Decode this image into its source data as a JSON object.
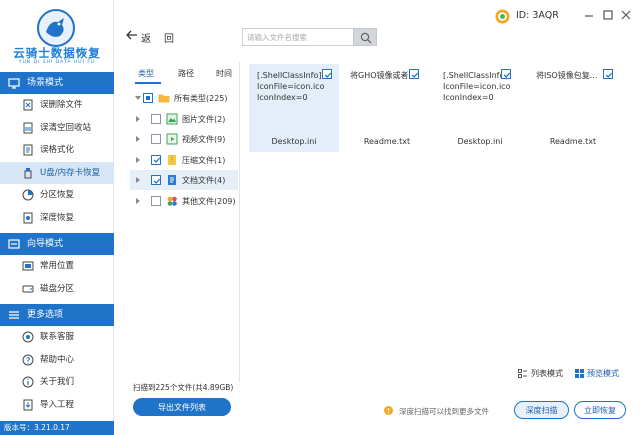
{
  "app": {
    "logo_title": "云骑士数据恢复",
    "logo_subtitle": "YUN QI SHI DATA HUI FU",
    "version_label": "版本号：3.21.0.17",
    "user_id": "ID: 3AQR",
    "accent_color": "#1f73c9"
  },
  "sidebar": {
    "sections": [
      {
        "title": "场景模式",
        "icon": "monitor-icon",
        "items": [
          {
            "label": "误删除文件",
            "icon": "file-delete-icon"
          },
          {
            "label": "误清空回收站",
            "icon": "recycle-bin-icon"
          },
          {
            "label": "误格式化",
            "icon": "format-icon"
          },
          {
            "label": "U盘/内存卡恢复",
            "icon": "usb-icon",
            "active": true
          },
          {
            "label": "分区恢复",
            "icon": "partition-icon"
          },
          {
            "label": "深度恢复",
            "icon": "deep-recovery-icon"
          }
        ]
      },
      {
        "title": "向导模式",
        "icon": "guide-icon",
        "items": [
          {
            "label": "常用位置",
            "icon": "location-icon"
          },
          {
            "label": "磁盘分区",
            "icon": "disk-icon"
          }
        ]
      },
      {
        "title": "更多选项",
        "icon": "menu-icon",
        "items": [
          {
            "label": "联系客服",
            "icon": "customer-service-icon"
          },
          {
            "label": "帮助中心",
            "icon": "help-icon"
          },
          {
            "label": "关于我们",
            "icon": "info-icon"
          },
          {
            "label": "导入工程",
            "icon": "import-icon"
          }
        ]
      }
    ]
  },
  "toolbar": {
    "back_label": "返",
    "home_label": "回",
    "search_placeholder": "请输入文件名搜索"
  },
  "tree": {
    "tabs": [
      "类型",
      "路径",
      "时间"
    ],
    "active_tab": 0,
    "rows": [
      {
        "label": "所有类型(225)",
        "checked": "partial",
        "icon": "folder-icon",
        "expandable": false,
        "level": 0
      },
      {
        "label": "图片文件(2)",
        "checked": false,
        "icon": "image-file-icon",
        "expandable": true,
        "level": 1
      },
      {
        "label": "视频文件(9)",
        "checked": false,
        "icon": "video-file-icon",
        "expandable": true,
        "level": 1
      },
      {
        "label": "压缩文件(1)",
        "checked": true,
        "icon": "archive-file-icon",
        "expandable": true,
        "level": 1
      },
      {
        "label": "文档文件(4)",
        "checked": true,
        "icon": "document-file-icon",
        "expandable": true,
        "level": 1,
        "selected": true
      },
      {
        "label": "其他文件(209)",
        "checked": false,
        "icon": "other-file-icon",
        "expandable": true,
        "level": 1
      }
    ]
  },
  "files": [
    {
      "content": "[.ShellClassInfo]\nIconFile=icon.ico\nIconIndex=0",
      "name": "Desktop.ini",
      "checked": true,
      "highlight": true
    },
    {
      "content": "将GHO镜像或者...",
      "name": "Readme.txt",
      "checked": true,
      "highlight": false
    },
    {
      "content": "[.ShellClassInfo]\nIconFile=icon.ico\nIconIndex=0",
      "name": "Desktop.ini",
      "checked": true,
      "highlight": false
    },
    {
      "content": "将ISO镜像包复...",
      "name": "Readme.txt",
      "checked": true,
      "highlight": false
    }
  ],
  "bottom": {
    "view_list_label": "列表模式",
    "view_preview_label": "预览模式",
    "scan_summary": "扫描到225个文件(共4.89GB)",
    "export_label": "导出文件列表",
    "tip_text": "深度扫描可以找到更多文件",
    "deep_scan_label": "深度扫描",
    "recover_label": "立即恢复"
  }
}
